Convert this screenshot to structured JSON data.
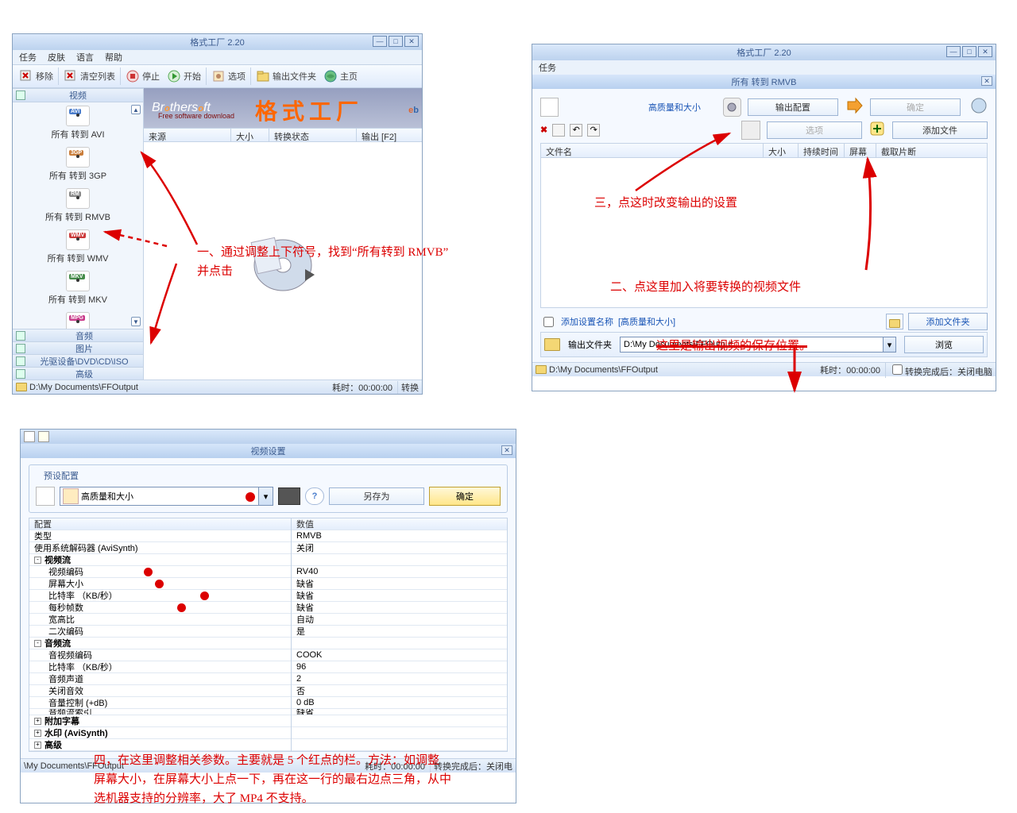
{
  "app_title": "格式工厂 2.20",
  "menu": [
    "任务",
    "皮肤",
    "语言",
    "帮助"
  ],
  "toolbar": {
    "remove": "移除",
    "clear": "清空列表",
    "stop": "停止",
    "start": "开始",
    "option": "选项",
    "out_folder": "输出文件夹",
    "home": "主页"
  },
  "sidebar": {
    "video_header": "视频",
    "items": [
      {
        "tag": "AVI",
        "cls": "avi",
        "label": "所有 转到 AVI"
      },
      {
        "tag": "3GP",
        "cls": "gp",
        "label": "所有 转到 3GP"
      },
      {
        "tag": "RM",
        "cls": "rmvb",
        "label": "所有 转到 RMVB"
      },
      {
        "tag": "WMV",
        "cls": "wmv",
        "label": "所有 转到 WMV"
      },
      {
        "tag": "MKV",
        "cls": "mkv",
        "label": "所有 转到 MKV"
      },
      {
        "tag": "MPG",
        "cls": "mpg",
        "label": "所有 转到 MPG"
      }
    ],
    "audio": "音频",
    "picture": "图片",
    "disc": "光驱设备\\DVD\\CD\\ISO",
    "advanced": "高级"
  },
  "brand": {
    "brothersoft": "Brothersoft",
    "sub": "Free software download",
    "name": "格式工厂"
  },
  "list_headers": {
    "source": "来源",
    "size": "大小",
    "status": "转换状态",
    "output": "输出 [F2]"
  },
  "status": {
    "path": "D:\\My Documents\\FFOutput",
    "elapsed": "耗时：00:00:00",
    "after": "转换",
    "after2": "转换完成后：关闭电脑"
  },
  "w2": {
    "title": "所有 转到 RMVB",
    "quality": "高质量和大小",
    "out_cfg": "输出配置",
    "ok": "确定",
    "option": "选项",
    "add_file": "添加文件",
    "cols": {
      "name": "文件名",
      "size": "大小",
      "duration": "持续时间",
      "screen": "屏幕",
      "clip": "截取片断"
    },
    "add_set": "添加设置名称",
    "add_set_val": "[高质量和大小]",
    "out_fold": "输出文件夹",
    "out_path": "D:\\My Documents\\FFOutput",
    "add_fold": "添加文件夹",
    "browse": "浏览"
  },
  "w3": {
    "title": "视频设置",
    "preset": "预设配置",
    "preset_val": "高质量和大小",
    "save_as": "另存为",
    "ok": "确定",
    "chdr": {
      "c1": "配置",
      "c2": "数值"
    },
    "rows": [
      {
        "k": "类型",
        "v": "RMVB"
      },
      {
        "k": "使用系统解码器 (AviSynth)",
        "v": "关闭"
      },
      {
        "k": "视频流",
        "v": "",
        "bold": true,
        "exp": "-"
      },
      {
        "k": "视频编码",
        "v": "RV40",
        "dot": true,
        "ind": 1
      },
      {
        "k": "屏幕大小",
        "v": "缺省",
        "dot": true,
        "ind": 1
      },
      {
        "k": "比特率 （KB/秒）",
        "v": "缺省",
        "dot": true,
        "ind": 1
      },
      {
        "k": "每秒帧数",
        "v": "缺省",
        "dot": true,
        "ind": 1
      },
      {
        "k": "宽高比",
        "v": "自动",
        "ind": 1
      },
      {
        "k": "二次编码",
        "v": "是",
        "ind": 1
      },
      {
        "k": "音频流",
        "v": "",
        "bold": true,
        "exp": "-"
      },
      {
        "k": "音视频编码",
        "v": "COOK",
        "ind": 1
      },
      {
        "k": "比特率 （KB/秒）",
        "v": "96",
        "ind": 1
      },
      {
        "k": "音频声道",
        "v": "2",
        "ind": 1
      },
      {
        "k": "关闭音效",
        "v": "否",
        "ind": 1
      },
      {
        "k": "音量控制 (+dB)",
        "v": "0 dB",
        "ind": 1
      },
      {
        "k": "音频流索引",
        "v": "缺省",
        "ind": 1,
        "cut": true
      },
      {
        "k": "附加字幕",
        "v": "",
        "bold": true,
        "exp": "+"
      },
      {
        "k": "水印 (AviSynth)",
        "v": "",
        "bold": true,
        "exp": "+"
      },
      {
        "k": "高级",
        "v": "",
        "bold": true,
        "exp": "+"
      }
    ]
  },
  "ann": {
    "a1a": "一、通过调整上下符号，找到“所有转到 RMVB”",
    "a1b": "并点击",
    "a2": "二、点这里加入将要转换的视频文件",
    "a3": "三，点这时改变输出的设置",
    "a4": "这里是输出视频的保存位置。",
    "a5a": "四，在这里调整相关参数。主要就是 5 个红点的栏。方法：如调整",
    "a5b": "屏幕大小，在屏幕大小上点一下，再在这一行的最右边点三角，从中",
    "a5c": "选机器支持的分辨率，大了 MP4 不支持。"
  },
  "chart_data": null
}
